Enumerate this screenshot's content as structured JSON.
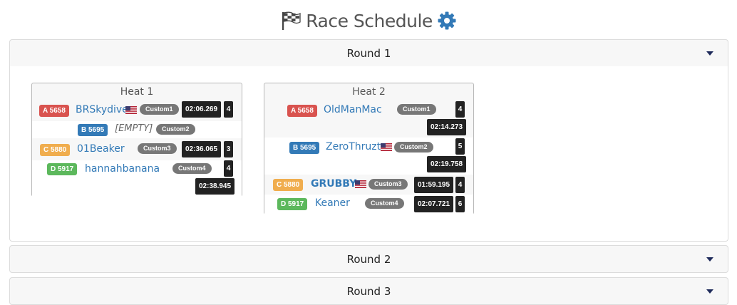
{
  "page": {
    "title": "Race Schedule"
  },
  "rounds": [
    {
      "label": "Round 1",
      "expanded": true,
      "heats": [
        {
          "title": "Heat 1",
          "slots": [
            {
              "chip": "A 5658",
              "pilot": "BRSkydive",
              "flag": true,
              "custom": "Custom1",
              "time": "02:06.269",
              "lap": "4"
            },
            {
              "chip": "B 5695",
              "pilot": "[EMPTY]",
              "flag": false,
              "custom": "Custom2",
              "time": "",
              "lap": ""
            },
            {
              "chip": "C 5880",
              "pilot": "01Beaker",
              "flag": false,
              "custom": "Custom3",
              "time": "02:36.065",
              "lap": "3"
            },
            {
              "chip": "D 5917",
              "pilot": "hannahbanana",
              "flag": false,
              "custom": "Custom4",
              "time": "02:38.945",
              "lap": "4"
            }
          ]
        },
        {
          "title": "Heat 2",
          "slots": [
            {
              "chip": "A 5658",
              "pilot": "OldManMac",
              "flag": false,
              "custom": "Custom1",
              "time": "02:14.273",
              "lap": "4"
            },
            {
              "chip": "B 5695",
              "pilot": "ZeroThruzt",
              "flag": true,
              "custom": "Custom2",
              "time": "02:19.758",
              "lap": "5"
            },
            {
              "chip": "C 5880",
              "pilot": "GRUBBY",
              "flag": true,
              "custom": "Custom3",
              "time": "01:59.195",
              "lap": "4"
            },
            {
              "chip": "D 5917",
              "pilot": "Keaner",
              "flag": false,
              "custom": "Custom4",
              "time": "02:07.721",
              "lap": "6"
            }
          ]
        }
      ]
    },
    {
      "label": "Round 2",
      "expanded": false
    },
    {
      "label": "Round 3",
      "expanded": false
    }
  ],
  "colors": {
    "chip_a": "#d9534f",
    "chip_b": "#337ab7",
    "chip_c": "#f0ad4e",
    "chip_d": "#5cb85c",
    "pilot_link": "#337ab7",
    "gear": "#337ab7"
  },
  "icons": {
    "title_icon": "checkered-flag-icon",
    "settings_icon": "gear-icon",
    "pilot_flag": "us-flag-icon",
    "expand": "caret-down-icon"
  }
}
